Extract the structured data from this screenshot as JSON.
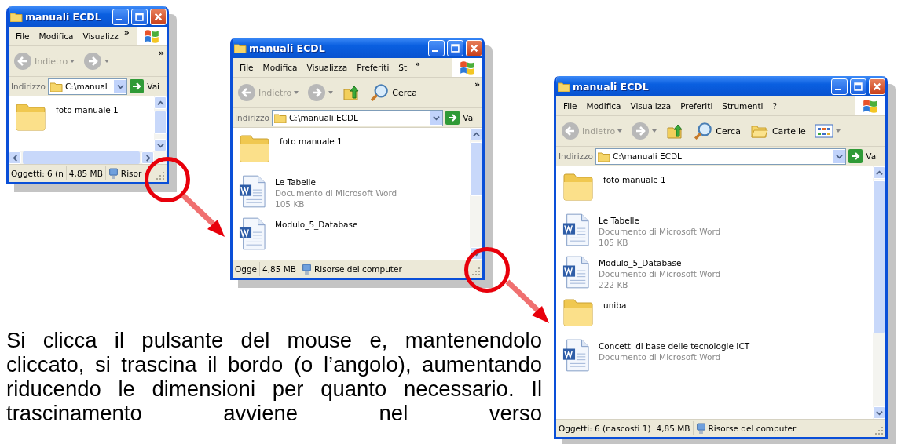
{
  "windows": [
    {
      "title": "manuali ECDL",
      "menu": [
        "File",
        "Modifica",
        "Visualizz"
      ],
      "menu_more": "»",
      "toolbar": [
        {
          "kind": "back",
          "label": "Indietro"
        },
        {
          "kind": "forward"
        }
      ],
      "toolbar_more": "»",
      "address": {
        "label": "Indirizzo",
        "value": "C:\\manual",
        "go": "Vai"
      },
      "files": [
        {
          "kind": "folder",
          "name": "foto manuale 1"
        }
      ],
      "horizontal_scrollbar": true,
      "status": [
        {
          "kind": "text",
          "text": "Oggetti: 6 (n"
        },
        {
          "kind": "text",
          "text": "4,85 MB"
        },
        {
          "kind": "computer",
          "text": "Risor"
        }
      ]
    },
    {
      "title": "manuali ECDL",
      "menu": [
        "File",
        "Modifica",
        "Visualizza",
        "Preferiti",
        "Sti"
      ],
      "menu_more": "»",
      "toolbar": [
        {
          "kind": "back",
          "label": "Indietro"
        },
        {
          "kind": "forward"
        },
        {
          "kind": "up"
        },
        {
          "kind": "search",
          "label": "Cerca"
        }
      ],
      "toolbar_more": "»",
      "address": {
        "label": "Indirizzo",
        "value": "C:\\manuali ECDL",
        "go": "Vai"
      },
      "files": [
        {
          "kind": "folder",
          "name": "foto manuale 1"
        },
        {
          "kind": "word",
          "name": "Le Tabelle",
          "details": [
            "Documento di Microsoft Word",
            "105 KB"
          ]
        },
        {
          "kind": "word",
          "name": "Modulo_5_Database"
        }
      ],
      "horizontal_scrollbar": false,
      "status": [
        {
          "kind": "text",
          "text": "Ogge"
        },
        {
          "kind": "text",
          "text": "4,85 MB"
        },
        {
          "kind": "computer",
          "text": "Risorse del computer"
        }
      ]
    },
    {
      "title": "manuali ECDL",
      "menu": [
        "File",
        "Modifica",
        "Visualizza",
        "Preferiti",
        "Strumenti",
        "?"
      ],
      "toolbar": [
        {
          "kind": "back",
          "label": "Indietro"
        },
        {
          "kind": "forward"
        },
        {
          "kind": "up"
        },
        {
          "kind": "search",
          "label": "Cerca"
        },
        {
          "kind": "folders",
          "label": "Cartelle"
        },
        {
          "kind": "views"
        }
      ],
      "address": {
        "label": "Indirizzo",
        "value": "C:\\manuali ECDL",
        "go": "Vai"
      },
      "files": [
        {
          "kind": "folder",
          "name": "foto manuale 1"
        },
        {
          "kind": "word",
          "name": "Le Tabelle",
          "details": [
            "Documento di Microsoft Word",
            "105 KB"
          ]
        },
        {
          "kind": "word",
          "name": "Modulo_5_Database",
          "details": [
            "Documento di Microsoft Word",
            "222 KB"
          ]
        },
        {
          "kind": "folder",
          "name": "uniba"
        },
        {
          "kind": "word",
          "name": "Concetti di base delle tecnologie ICT",
          "details": [
            "Documento di Microsoft Word"
          ]
        }
      ],
      "horizontal_scrollbar": false,
      "status": [
        {
          "kind": "text",
          "text": "Oggetti: 6 (nascosti 1)"
        },
        {
          "kind": "text",
          "text": "4,85 MB"
        },
        {
          "kind": "computer",
          "text": "Risorse del computer"
        }
      ]
    }
  ],
  "paragraph": "Si clicca il pulsante del mouse e, mantenendolo cliccato, si trascina il bordo (o l’angolo), aumentando  riducendo le dimensioni per quanto necessario. Il trascinamento avviene nel verso"
}
